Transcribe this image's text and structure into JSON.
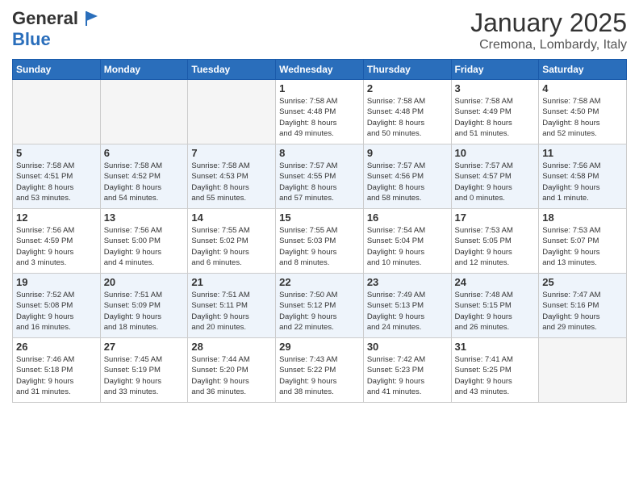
{
  "header": {
    "logo": {
      "general": "General",
      "blue": "Blue"
    },
    "title": "January 2025",
    "subtitle": "Cremona, Lombardy, Italy"
  },
  "weekdays": [
    "Sunday",
    "Monday",
    "Tuesday",
    "Wednesday",
    "Thursday",
    "Friday",
    "Saturday"
  ],
  "weeks": [
    [
      {
        "day": "",
        "info": ""
      },
      {
        "day": "",
        "info": ""
      },
      {
        "day": "",
        "info": ""
      },
      {
        "day": "1",
        "info": "Sunrise: 7:58 AM\nSunset: 4:48 PM\nDaylight: 8 hours\nand 49 minutes."
      },
      {
        "day": "2",
        "info": "Sunrise: 7:58 AM\nSunset: 4:48 PM\nDaylight: 8 hours\nand 50 minutes."
      },
      {
        "day": "3",
        "info": "Sunrise: 7:58 AM\nSunset: 4:49 PM\nDaylight: 8 hours\nand 51 minutes."
      },
      {
        "day": "4",
        "info": "Sunrise: 7:58 AM\nSunset: 4:50 PM\nDaylight: 8 hours\nand 52 minutes."
      }
    ],
    [
      {
        "day": "5",
        "info": "Sunrise: 7:58 AM\nSunset: 4:51 PM\nDaylight: 8 hours\nand 53 minutes."
      },
      {
        "day": "6",
        "info": "Sunrise: 7:58 AM\nSunset: 4:52 PM\nDaylight: 8 hours\nand 54 minutes."
      },
      {
        "day": "7",
        "info": "Sunrise: 7:58 AM\nSunset: 4:53 PM\nDaylight: 8 hours\nand 55 minutes."
      },
      {
        "day": "8",
        "info": "Sunrise: 7:57 AM\nSunset: 4:55 PM\nDaylight: 8 hours\nand 57 minutes."
      },
      {
        "day": "9",
        "info": "Sunrise: 7:57 AM\nSunset: 4:56 PM\nDaylight: 8 hours\nand 58 minutes."
      },
      {
        "day": "10",
        "info": "Sunrise: 7:57 AM\nSunset: 4:57 PM\nDaylight: 9 hours\nand 0 minutes."
      },
      {
        "day": "11",
        "info": "Sunrise: 7:56 AM\nSunset: 4:58 PM\nDaylight: 9 hours\nand 1 minute."
      }
    ],
    [
      {
        "day": "12",
        "info": "Sunrise: 7:56 AM\nSunset: 4:59 PM\nDaylight: 9 hours\nand 3 minutes."
      },
      {
        "day": "13",
        "info": "Sunrise: 7:56 AM\nSunset: 5:00 PM\nDaylight: 9 hours\nand 4 minutes."
      },
      {
        "day": "14",
        "info": "Sunrise: 7:55 AM\nSunset: 5:02 PM\nDaylight: 9 hours\nand 6 minutes."
      },
      {
        "day": "15",
        "info": "Sunrise: 7:55 AM\nSunset: 5:03 PM\nDaylight: 9 hours\nand 8 minutes."
      },
      {
        "day": "16",
        "info": "Sunrise: 7:54 AM\nSunset: 5:04 PM\nDaylight: 9 hours\nand 10 minutes."
      },
      {
        "day": "17",
        "info": "Sunrise: 7:53 AM\nSunset: 5:05 PM\nDaylight: 9 hours\nand 12 minutes."
      },
      {
        "day": "18",
        "info": "Sunrise: 7:53 AM\nSunset: 5:07 PM\nDaylight: 9 hours\nand 13 minutes."
      }
    ],
    [
      {
        "day": "19",
        "info": "Sunrise: 7:52 AM\nSunset: 5:08 PM\nDaylight: 9 hours\nand 16 minutes."
      },
      {
        "day": "20",
        "info": "Sunrise: 7:51 AM\nSunset: 5:09 PM\nDaylight: 9 hours\nand 18 minutes."
      },
      {
        "day": "21",
        "info": "Sunrise: 7:51 AM\nSunset: 5:11 PM\nDaylight: 9 hours\nand 20 minutes."
      },
      {
        "day": "22",
        "info": "Sunrise: 7:50 AM\nSunset: 5:12 PM\nDaylight: 9 hours\nand 22 minutes."
      },
      {
        "day": "23",
        "info": "Sunrise: 7:49 AM\nSunset: 5:13 PM\nDaylight: 9 hours\nand 24 minutes."
      },
      {
        "day": "24",
        "info": "Sunrise: 7:48 AM\nSunset: 5:15 PM\nDaylight: 9 hours\nand 26 minutes."
      },
      {
        "day": "25",
        "info": "Sunrise: 7:47 AM\nSunset: 5:16 PM\nDaylight: 9 hours\nand 29 minutes."
      }
    ],
    [
      {
        "day": "26",
        "info": "Sunrise: 7:46 AM\nSunset: 5:18 PM\nDaylight: 9 hours\nand 31 minutes."
      },
      {
        "day": "27",
        "info": "Sunrise: 7:45 AM\nSunset: 5:19 PM\nDaylight: 9 hours\nand 33 minutes."
      },
      {
        "day": "28",
        "info": "Sunrise: 7:44 AM\nSunset: 5:20 PM\nDaylight: 9 hours\nand 36 minutes."
      },
      {
        "day": "29",
        "info": "Sunrise: 7:43 AM\nSunset: 5:22 PM\nDaylight: 9 hours\nand 38 minutes."
      },
      {
        "day": "30",
        "info": "Sunrise: 7:42 AM\nSunset: 5:23 PM\nDaylight: 9 hours\nand 41 minutes."
      },
      {
        "day": "31",
        "info": "Sunrise: 7:41 AM\nSunset: 5:25 PM\nDaylight: 9 hours\nand 43 minutes."
      },
      {
        "day": "",
        "info": ""
      }
    ]
  ]
}
